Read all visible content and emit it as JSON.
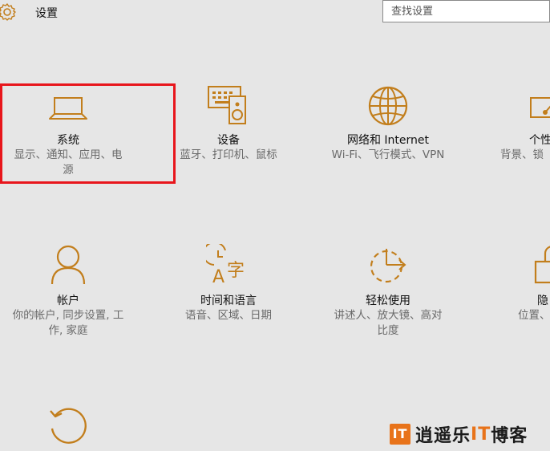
{
  "header": {
    "title": "设置",
    "search_placeholder": "查找设置"
  },
  "tiles": [
    {
      "name": "系统",
      "desc": "显示、通知、应用、电\n源",
      "icon": "laptop-icon"
    },
    {
      "name": "设备",
      "desc": "蓝牙、打印机、鼠标",
      "icon": "devices-icon"
    },
    {
      "name": "网络和 Internet",
      "desc": "Wi-Fi、飞行模式、VPN",
      "icon": "globe-icon"
    },
    {
      "name": "个性",
      "desc": "背景、锁",
      "icon": "personalization-icon"
    },
    {
      "name": "帐户",
      "desc": "你的帐户, 同步设置, 工\n作, 家庭",
      "icon": "person-icon"
    },
    {
      "name": "时间和语言",
      "desc": "语音、区域、日期",
      "icon": "time-language-icon"
    },
    {
      "name": "轻松使用",
      "desc": "讲述人、放大镜、高对\n比度",
      "icon": "ease-of-access-icon"
    },
    {
      "name": "隐",
      "desc": "位置、",
      "icon": "lock-icon"
    },
    {
      "name": "",
      "desc": "",
      "icon": "update-icon"
    }
  ],
  "accent_color": "#c27e1c",
  "highlight_color": "#e8161c",
  "watermark": {
    "badge": "IT",
    "text_a": "逍遥乐",
    "text_it": "IT",
    "text_b": "博客"
  }
}
